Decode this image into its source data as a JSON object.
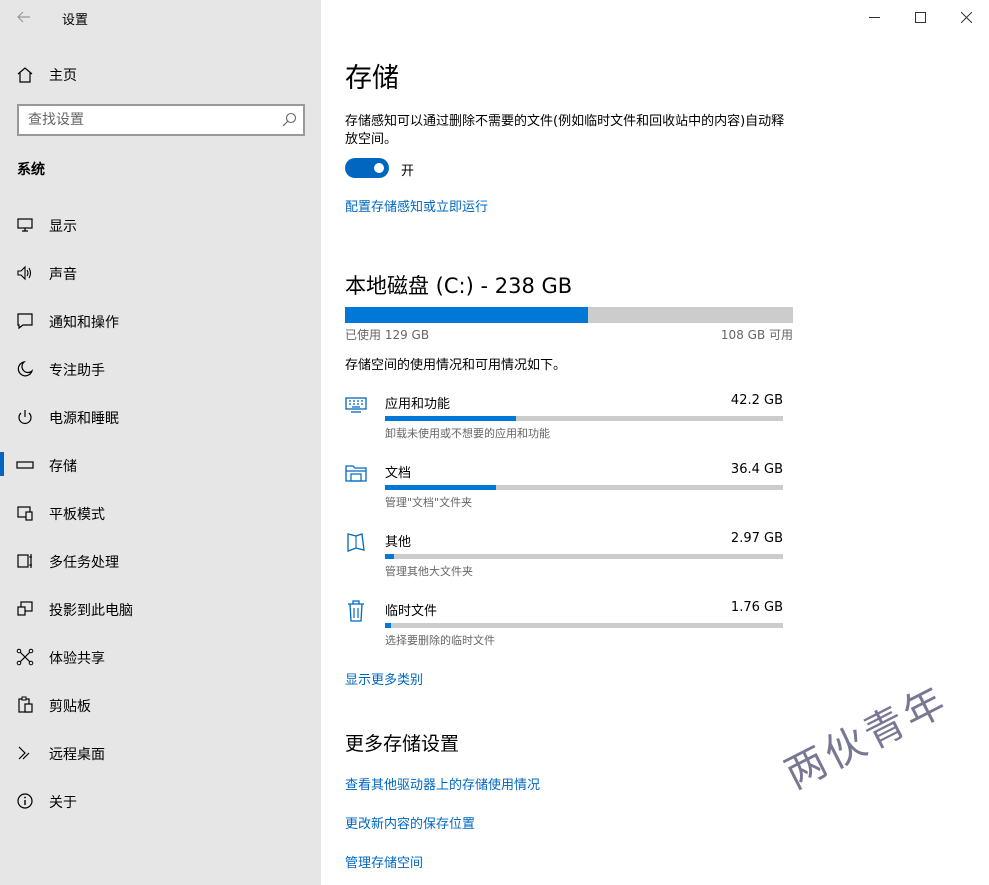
{
  "window": {
    "title": "设置",
    "minimize": "—",
    "maximize": "☐",
    "close": "✕"
  },
  "sidebar": {
    "home_label": "主页",
    "search_placeholder": "查找设置",
    "group_title": "系统",
    "items": [
      {
        "label": "显示",
        "icon": "monitor-icon"
      },
      {
        "label": "声音",
        "icon": "speaker-icon"
      },
      {
        "label": "通知和操作",
        "icon": "message-icon"
      },
      {
        "label": "专注助手",
        "icon": "moon-icon"
      },
      {
        "label": "电源和睡眠",
        "icon": "power-icon"
      },
      {
        "label": "存储",
        "icon": "storage-icon",
        "active": true
      },
      {
        "label": "平板模式",
        "icon": "tablet-icon"
      },
      {
        "label": "多任务处理",
        "icon": "multitask-icon"
      },
      {
        "label": "投影到此电脑",
        "icon": "project-icon"
      },
      {
        "label": "体验共享",
        "icon": "share-icon"
      },
      {
        "label": "剪贴板",
        "icon": "clipboard-icon"
      },
      {
        "label": "远程桌面",
        "icon": "remote-icon"
      },
      {
        "label": "关于",
        "icon": "info-icon"
      }
    ]
  },
  "main": {
    "title": "存储",
    "storage_sense_desc": "存储感知可以通过删除不需要的文件(例如临时文件和回收站中的内容)自动释放空间。",
    "toggle_state": "开",
    "toggle_on": true,
    "configure_link": "配置存储感知或立即运行",
    "disk_title": "本地磁盘 (C:) - 238 GB",
    "used_label": "已使用 129 GB",
    "free_label": "108 GB 可用",
    "used_fraction": 0.543,
    "usage_desc": "存储空间的使用情况和可用情况如下。",
    "categories": [
      {
        "name": "应用和功能",
        "size": "42.2 GB",
        "desc": "卸载未使用或不想要的应用和功能",
        "fraction": 0.33,
        "icon": "keyboard-icon"
      },
      {
        "name": "文档",
        "size": "36.4 GB",
        "desc": "管理\"文档\"文件夹",
        "fraction": 0.28,
        "icon": "folder-icon"
      },
      {
        "name": "其他",
        "size": "2.97 GB",
        "desc": "管理其他大文件夹",
        "fraction": 0.023,
        "icon": "other-files-icon"
      },
      {
        "name": "临时文件",
        "size": "1.76 GB",
        "desc": "选择要删除的临时文件",
        "fraction": 0.014,
        "icon": "trash-icon"
      }
    ],
    "show_more_link": "显示更多类别",
    "more_settings_title": "更多存储设置",
    "more_links": [
      "查看其他驱动器上的存储使用情况",
      "更改新内容的保存位置",
      "管理存储空间"
    ]
  },
  "watermark": "两伙青年",
  "colors": {
    "accent": "#0078d7",
    "link": "#0067c0",
    "sidebar_bg": "#e6e6e6",
    "bar_bg": "#cccccc"
  }
}
